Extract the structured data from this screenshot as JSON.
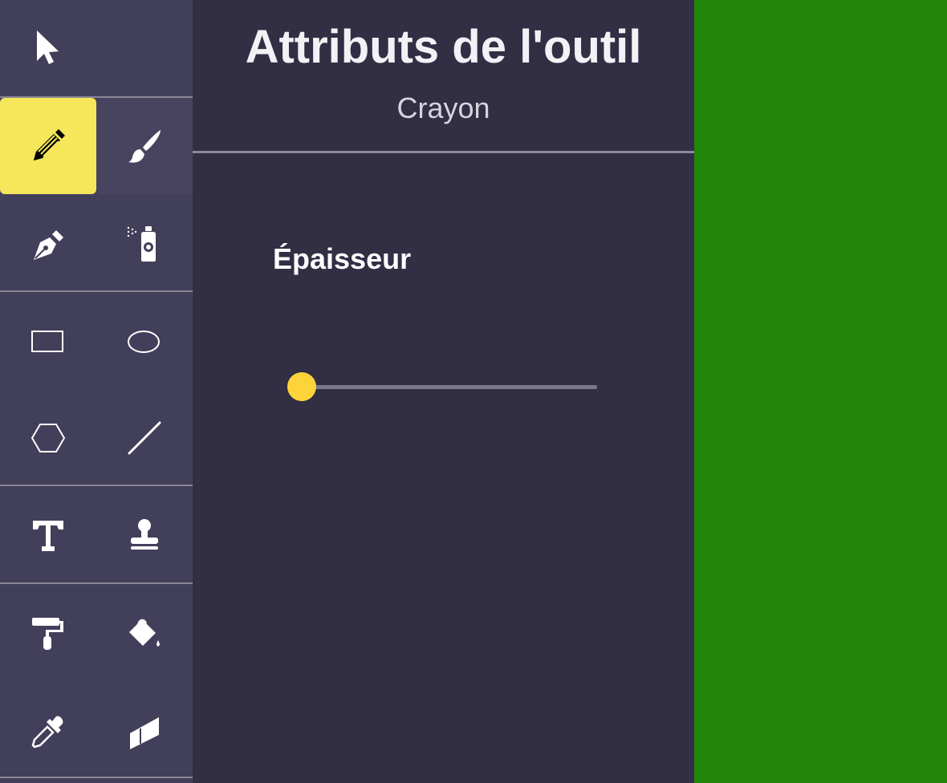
{
  "toolbar": {
    "tools": [
      {
        "id": "select",
        "icon": "cursor-arrow-icon",
        "state": "normal"
      },
      {
        "id": "pencil",
        "icon": "pencil-icon",
        "state": "selected"
      },
      {
        "id": "brush",
        "icon": "paintbrush-icon",
        "state": "hover"
      },
      {
        "id": "pen",
        "icon": "pen-nib-icon",
        "state": "normal"
      },
      {
        "id": "spray",
        "icon": "spray-can-icon",
        "state": "normal"
      },
      {
        "id": "rectangle",
        "icon": "rectangle-icon",
        "state": "normal"
      },
      {
        "id": "ellipse",
        "icon": "ellipse-icon",
        "state": "normal"
      },
      {
        "id": "polygon",
        "icon": "hexagon-icon",
        "state": "normal"
      },
      {
        "id": "line",
        "icon": "line-icon",
        "state": "normal"
      },
      {
        "id": "text",
        "icon": "text-icon",
        "state": "normal"
      },
      {
        "id": "stamp",
        "icon": "stamp-icon",
        "state": "normal"
      },
      {
        "id": "roller",
        "icon": "paint-roller-icon",
        "state": "normal"
      },
      {
        "id": "bucket",
        "icon": "fill-bucket-icon",
        "state": "normal"
      },
      {
        "id": "eyedropper",
        "icon": "eyedropper-icon",
        "state": "normal"
      },
      {
        "id": "eraser",
        "icon": "eraser-icon",
        "state": "normal"
      }
    ]
  },
  "panel": {
    "title": "Attributs de l'outil",
    "subtitle": "Crayon",
    "thickness_label": "Épaisseur",
    "thickness_slider": {
      "value": 0,
      "min": 0,
      "max": 100
    }
  },
  "canvas": {
    "background_color": "#22860a"
  },
  "colors": {
    "toolbar_bg": "#423f5a",
    "panel_bg": "#322e44",
    "selected_tool": "#f5e65a",
    "slider_thumb": "#fcd43a"
  }
}
